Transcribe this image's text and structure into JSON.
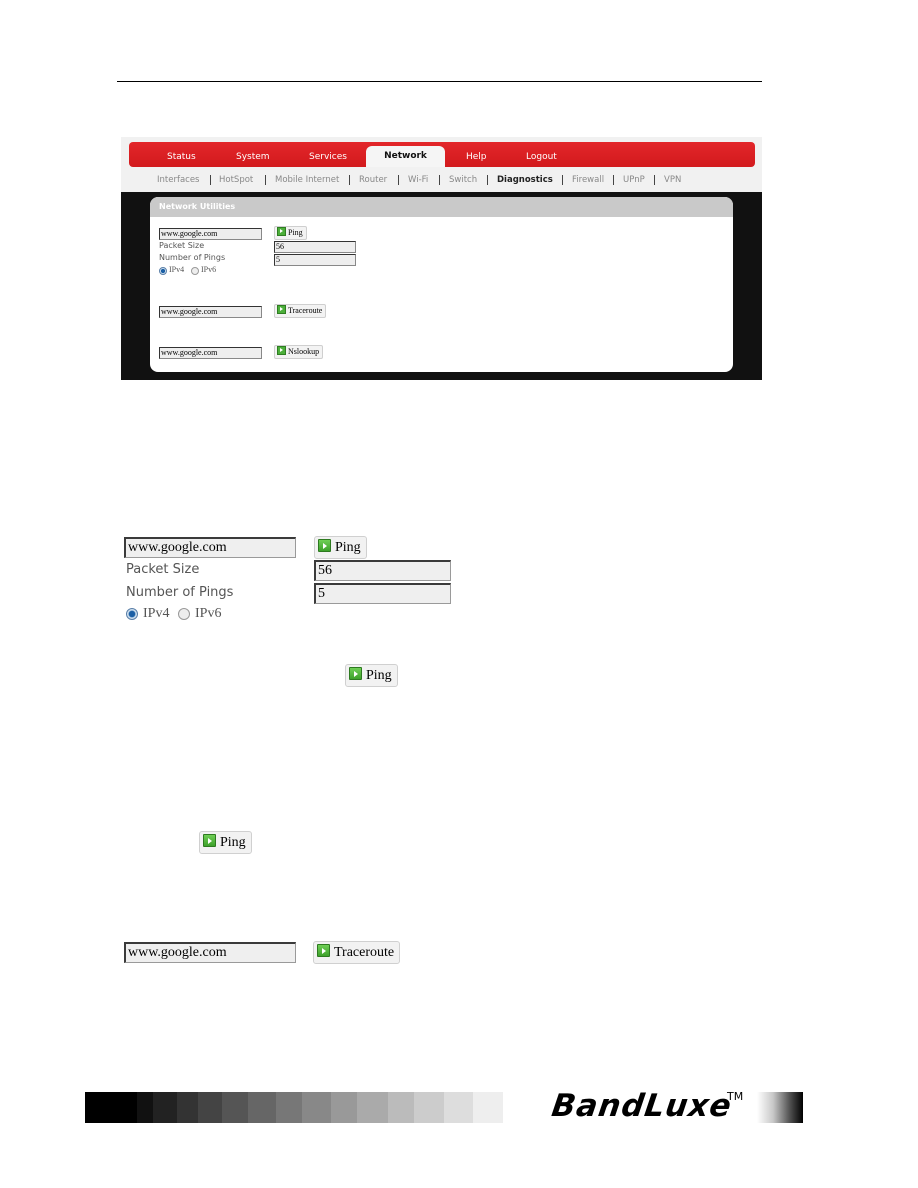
{
  "router_ui": {
    "main_tabs": [
      {
        "label": "Status",
        "active": false
      },
      {
        "label": "System",
        "active": false
      },
      {
        "label": "Services",
        "active": false
      },
      {
        "label": "Network",
        "active": true
      },
      {
        "label": "Help",
        "active": false
      },
      {
        "label": "Logout",
        "active": false
      }
    ],
    "sub_tabs": [
      {
        "label": "Interfaces",
        "active": false
      },
      {
        "label": "HotSpot",
        "active": false
      },
      {
        "label": "Mobile Internet",
        "active": false
      },
      {
        "label": "Router",
        "active": false
      },
      {
        "label": "Wi-Fi",
        "active": false
      },
      {
        "label": "Switch",
        "active": false
      },
      {
        "label": "Diagnostics",
        "active": true
      },
      {
        "label": "Firewall",
        "active": false
      },
      {
        "label": "UPnP",
        "active": false
      },
      {
        "label": "VPN",
        "active": false
      }
    ],
    "panel_title": "Network Utilities",
    "ping": {
      "host_value": "www.google.com",
      "button_label": "Ping",
      "packet_size_label": "Packet Size",
      "packet_size_value": "56",
      "num_pings_label": "Number of Pings",
      "num_pings_value": "5",
      "ipv4_label": "IPv4",
      "ipv6_label": "IPv6",
      "selected_protocol": "IPv4"
    },
    "traceroute": {
      "host_value": "www.google.com",
      "button_label": "Traceroute"
    },
    "nslookup": {
      "host_value": "www.google.com",
      "button_label": "Nslookup"
    }
  },
  "enlarged_ping": {
    "host_value": "www.google.com",
    "button_label": "Ping",
    "packet_size_label": "Packet Size",
    "packet_size_value": "56",
    "num_pings_label": "Number of Pings",
    "num_pings_value": "5",
    "ipv4_label": "IPv4",
    "ipv6_label": "IPv6"
  },
  "ping_button_callout_1": "Ping",
  "ping_button_callout_2": "Ping",
  "enlarged_traceroute": {
    "host_value": "www.google.com",
    "button_label": "Traceroute"
  },
  "footer": {
    "brand": "BandLuxe",
    "trademark": "TM",
    "grayscale_swatches": [
      "#000000",
      "#111111",
      "#222222",
      "#333333",
      "#444444",
      "#555555",
      "#666666",
      "#777777",
      "#888888",
      "#999999",
      "#aaaaaa",
      "#bbbbbb",
      "#cccccc",
      "#dddddd",
      "#eeeeee"
    ]
  },
  "colors": {
    "nav_red": "#d92023",
    "panel_header_gray": "#c9c9c9",
    "content_background_black": "#111111",
    "go_icon_green": "#4caf3a"
  }
}
